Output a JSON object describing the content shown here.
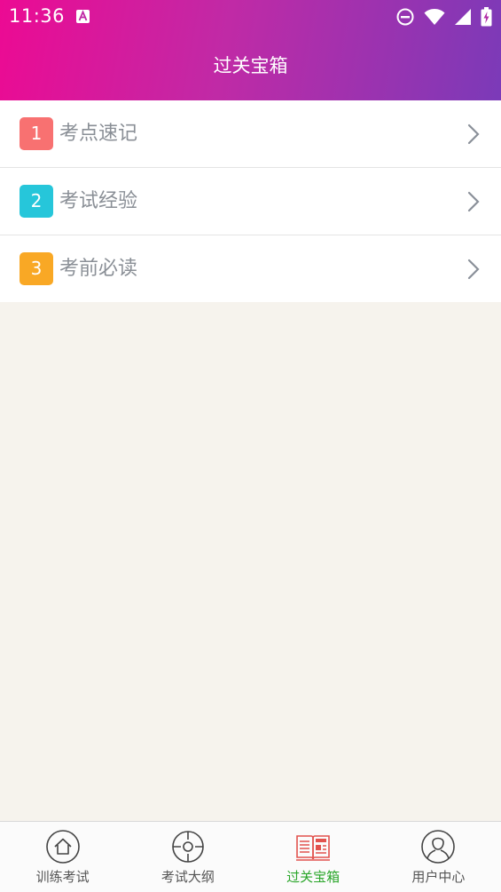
{
  "status_bar": {
    "time": "11:36"
  },
  "header": {
    "title": "过关宝箱"
  },
  "list": {
    "items": [
      {
        "number": "1",
        "label": "考点速记",
        "badge_color": "#f87171"
      },
      {
        "number": "2",
        "label": "考试经验",
        "badge_color": "#26c6da"
      },
      {
        "number": "3",
        "label": "考前必读",
        "badge_color": "#f9a825"
      }
    ]
  },
  "tabbar": {
    "active_color": "#2aa62a",
    "tabs": [
      {
        "label": "训练考试",
        "icon": "home-icon"
      },
      {
        "label": "考试大纲",
        "icon": "crosshair-icon"
      },
      {
        "label": "过关宝箱",
        "icon": "news-book-icon",
        "active": true
      },
      {
        "label": "用户中心",
        "icon": "user-icon"
      }
    ]
  }
}
